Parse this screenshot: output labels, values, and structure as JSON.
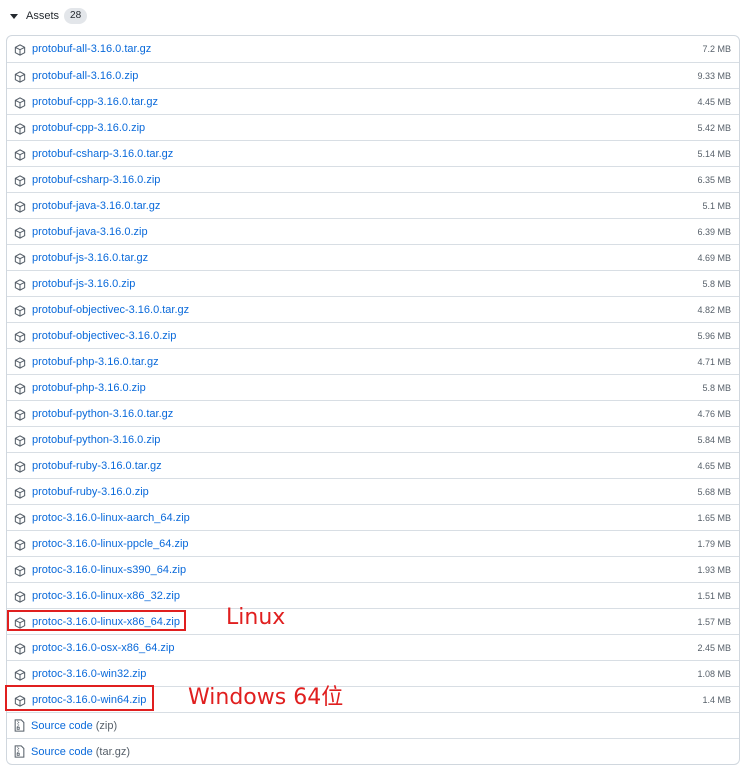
{
  "assets": {
    "title": "Assets",
    "count": "28",
    "items": [
      {
        "name": "protobuf-all-3.16.0.tar.gz",
        "size": "7.2 MB"
      },
      {
        "name": "protobuf-all-3.16.0.zip",
        "size": "9.33 MB"
      },
      {
        "name": "protobuf-cpp-3.16.0.tar.gz",
        "size": "4.45 MB"
      },
      {
        "name": "protobuf-cpp-3.16.0.zip",
        "size": "5.42 MB"
      },
      {
        "name": "protobuf-csharp-3.16.0.tar.gz",
        "size": "5.14 MB"
      },
      {
        "name": "protobuf-csharp-3.16.0.zip",
        "size": "6.35 MB"
      },
      {
        "name": "protobuf-java-3.16.0.tar.gz",
        "size": "5.1 MB"
      },
      {
        "name": "protobuf-java-3.16.0.zip",
        "size": "6.39 MB"
      },
      {
        "name": "protobuf-js-3.16.0.tar.gz",
        "size": "4.69 MB"
      },
      {
        "name": "protobuf-js-3.16.0.zip",
        "size": "5.8 MB"
      },
      {
        "name": "protobuf-objectivec-3.16.0.tar.gz",
        "size": "4.82 MB"
      },
      {
        "name": "protobuf-objectivec-3.16.0.zip",
        "size": "5.96 MB"
      },
      {
        "name": "protobuf-php-3.16.0.tar.gz",
        "size": "4.71 MB"
      },
      {
        "name": "protobuf-php-3.16.0.zip",
        "size": "5.8 MB"
      },
      {
        "name": "protobuf-python-3.16.0.tar.gz",
        "size": "4.76 MB"
      },
      {
        "name": "protobuf-python-3.16.0.zip",
        "size": "5.84 MB"
      },
      {
        "name": "protobuf-ruby-3.16.0.tar.gz",
        "size": "4.65 MB"
      },
      {
        "name": "protobuf-ruby-3.16.0.zip",
        "size": "5.68 MB"
      },
      {
        "name": "protoc-3.16.0-linux-aarch_64.zip",
        "size": "1.65 MB"
      },
      {
        "name": "protoc-3.16.0-linux-ppcle_64.zip",
        "size": "1.79 MB"
      },
      {
        "name": "protoc-3.16.0-linux-s390_64.zip",
        "size": "1.93 MB"
      },
      {
        "name": "protoc-3.16.0-linux-x86_32.zip",
        "size": "1.51 MB"
      },
      {
        "name": "protoc-3.16.0-linux-x86_64.zip",
        "size": "1.57 MB"
      },
      {
        "name": "protoc-3.16.0-osx-x86_64.zip",
        "size": "2.45 MB"
      },
      {
        "name": "protoc-3.16.0-win32.zip",
        "size": "1.08 MB"
      },
      {
        "name": "protoc-3.16.0-win64.zip",
        "size": "1.4 MB"
      }
    ],
    "source_code": [
      {
        "label": "Source code",
        "format": "(zip)"
      },
      {
        "label": "Source code",
        "format": "(tar.gz)"
      }
    ]
  },
  "annotations": {
    "linux": "Linux",
    "windows": "Windows 64位"
  },
  "colors": {
    "link": "#0969da",
    "highlight": "#e01f1f"
  },
  "icons": {
    "asset": "package-icon",
    "source": "file-zip-icon",
    "toggle": "triangle-down-icon"
  }
}
